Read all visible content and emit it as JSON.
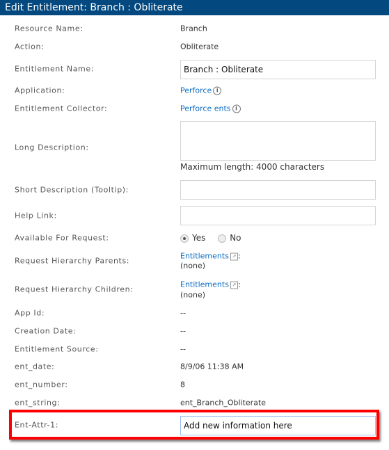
{
  "header": {
    "title": "Edit Entitlement: Branch : Obliterate"
  },
  "fields": {
    "resource_name": {
      "label": "Resource Name:",
      "value": "Branch"
    },
    "action": {
      "label": "Action:",
      "value": "Obliterate"
    },
    "entitlement_name": {
      "label": "Entitlement Name:",
      "value": "Branch : Obliterate"
    },
    "application": {
      "label": "Application:",
      "value": "Perforce"
    },
    "collector": {
      "label": "Entitlement Collector:",
      "value": "Perforce ents"
    },
    "long_description": {
      "label": "Long Description:",
      "value": "",
      "hint": "Maximum length: 4000 characters"
    },
    "short_description": {
      "label": "Short Description (Tooltip):",
      "value": ""
    },
    "help_link": {
      "label": "Help Link:",
      "value": ""
    },
    "available": {
      "label": "Available For Request:",
      "yes": "Yes",
      "no": "No",
      "selected": "Yes"
    },
    "parents": {
      "label": "Request Hierarchy Parents:",
      "link": "Entitlements",
      "colon": ":",
      "value": "(none)"
    },
    "children": {
      "label": "Request Hierarchy Children:",
      "link": "Entitlements",
      "colon": ":",
      "value": "(none)"
    },
    "app_id": {
      "label": "App Id:",
      "value": "--"
    },
    "creation_date": {
      "label": "Creation Date:",
      "value": "--"
    },
    "source": {
      "label": "Entitlement Source:",
      "value": "--"
    },
    "ent_date": {
      "label": "ent_date:",
      "value": "8/9/06 11:38 AM"
    },
    "ent_number": {
      "label": "ent_number:",
      "value": "8"
    },
    "ent_string": {
      "label": "ent_string:",
      "value": "ent_Branch_Obliterate"
    },
    "ent_attr_1": {
      "label": "Ent-Attr-1:",
      "value": "Add new information here"
    }
  },
  "colors": {
    "header": "#03487f",
    "link": "#0a6cc2",
    "highlight": "#ff0000"
  }
}
